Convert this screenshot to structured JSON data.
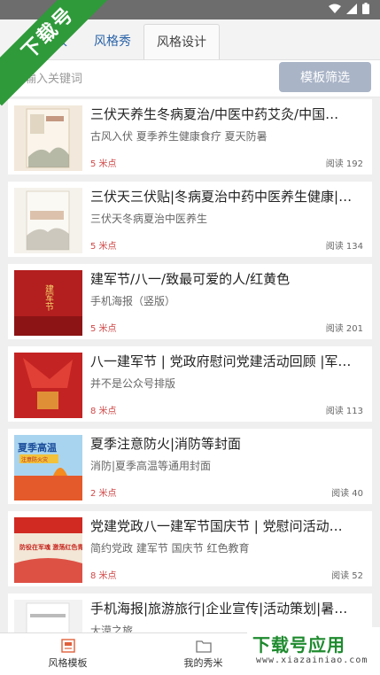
{
  "watermark": {
    "text": "下载号"
  },
  "tabs": [
    {
      "label": "模板"
    },
    {
      "label": "风格秀"
    },
    {
      "label": "风格设计"
    }
  ],
  "search": {
    "placeholder": "输入关键词",
    "filter_label": "模板筛选"
  },
  "cards": [
    {
      "title": "三伏天养生冬病夏治/中医中药艾灸/中国…",
      "subtitle": "古风入伏 夏季养生健康食疗 夏天防暑",
      "points": "5 米点",
      "reads": "阅读 192"
    },
    {
      "title": "三伏天三伏贴|冬病夏治中药中医养生健康|…",
      "subtitle": "三伏天冬病夏治中医养生",
      "points": "5 米点",
      "reads": "阅读 134"
    },
    {
      "title": "建军节/八一/致最可爱的人/红黄色",
      "subtitle": "手机海报（竖版）",
      "points": "5 米点",
      "reads": "阅读 201"
    },
    {
      "title": "八一建军节 | 党政府慰问党建活动回顾 |军…",
      "subtitle": "并不是公众号排版",
      "points": "8 米点",
      "reads": "阅读 113"
    },
    {
      "title": "夏季注意防火|消防等封面",
      "subtitle": "消防|夏季高温等通用封面",
      "points": "2 米点",
      "reads": "阅读 40"
    },
    {
      "title": "党建党政八一建军节国庆节 | 党慰问活动…",
      "subtitle": "简约党政 建军节 国庆节 红色教育",
      "points": "8 米点",
      "reads": "阅读 52"
    },
    {
      "title": "手机海报|旅游旅行|企业宣传|活动策划|暑…",
      "subtitle": "大漠之旅",
      "points": "",
      "reads": ""
    }
  ],
  "thumb_text": {
    "t3": "建军节",
    "t5_head": "夏季高温",
    "t5_sub": "注意防火灾",
    "t6": "防役在军魂 激荡红色青春"
  },
  "bottom_nav": [
    {
      "label": "风格模板",
      "icon": "template-icon"
    },
    {
      "label": "我的秀米",
      "icon": "folder-icon"
    }
  ],
  "logo": {
    "main": "下载号应用",
    "url": "www.xiazainiao.com"
  },
  "colors": {
    "status_bar": "#6d6d6d",
    "tab_link": "#2a63a8",
    "filter_button": "#a9b4c7",
    "points": "#d04848",
    "watermark_green": "#2f9a3a"
  }
}
